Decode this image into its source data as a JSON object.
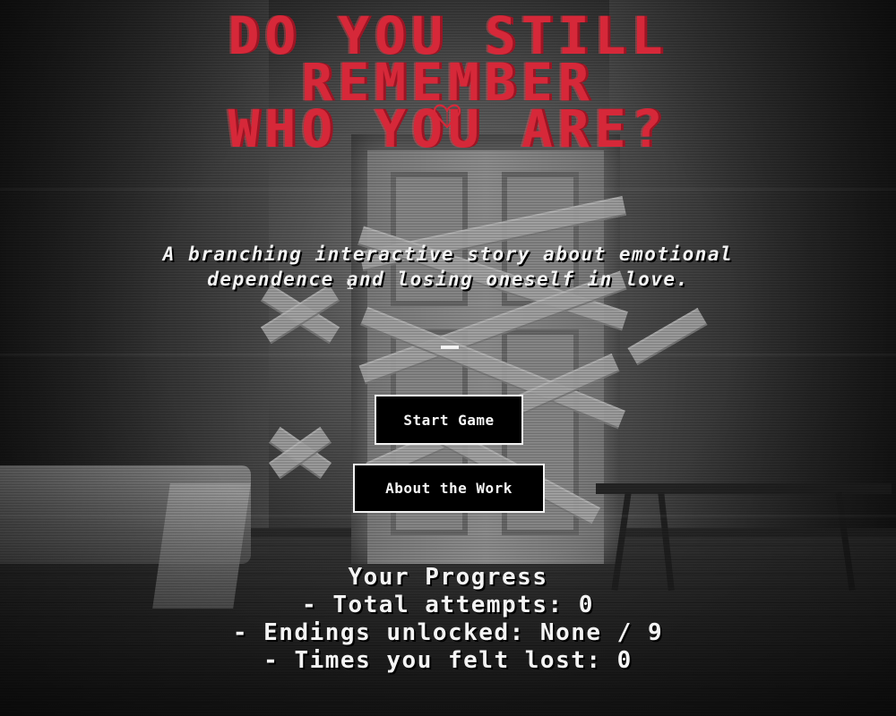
{
  "title": {
    "line1": "DO YOU STILL",
    "line2": "REMEMBER",
    "line3": "WHO YOU ARE?"
  },
  "subtitle": {
    "line1": "A branching interactive story about emotional",
    "line2": "dependence and losing oneself in love."
  },
  "buttons": {
    "start_label": "Start Game",
    "about_label": "About the Work"
  },
  "progress": {
    "heading": "Your Progress",
    "attempts": "- Total attempts: 0",
    "endings": "- Endings unlocked: None / 9",
    "lost": "- Times you felt lost: 0"
  },
  "icons": {
    "heart": "heart-icon",
    "cursor": "text-cursor-icon"
  },
  "colors": {
    "title": "#d62839",
    "text": "#f2f2f2",
    "button_bg": "#000000",
    "button_border": "#f2f2f2"
  }
}
